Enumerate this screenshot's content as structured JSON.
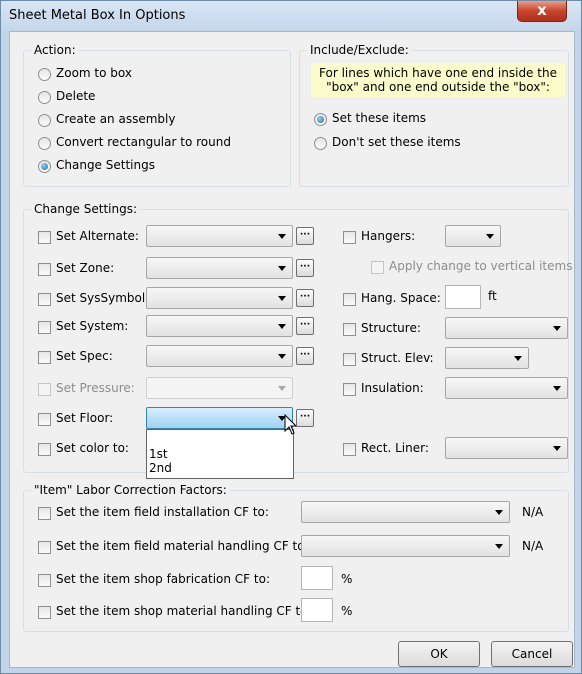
{
  "window": {
    "title": "Sheet Metal Box In Options",
    "close_glyph": "x"
  },
  "action": {
    "group_label": "Action:",
    "options": [
      {
        "label": "Zoom to box",
        "selected": false
      },
      {
        "label": "Delete",
        "selected": false
      },
      {
        "label": "Create an assembly",
        "selected": false
      },
      {
        "label": "Convert rectangular to round",
        "selected": false
      },
      {
        "label": "Change Settings",
        "selected": true
      }
    ]
  },
  "include": {
    "group_label": "Include/Exclude:",
    "note": "For lines which have one end inside the \"box\" and one end outside the \"box\":",
    "options": [
      {
        "label": "Set these items",
        "selected": true
      },
      {
        "label": "Don't set these items",
        "selected": false
      }
    ]
  },
  "settings": {
    "group_label": "Change Settings:",
    "left": [
      {
        "label": "Set Alternate:",
        "enabled": true,
        "checked": false
      },
      {
        "label": "Set Zone:",
        "enabled": true,
        "checked": false
      },
      {
        "label": "Set SysSymbol:",
        "enabled": true,
        "checked": false
      },
      {
        "label": "Set System:",
        "enabled": true,
        "checked": false
      },
      {
        "label": "Set Spec:",
        "enabled": true,
        "checked": false
      },
      {
        "label": "Set Pressure:",
        "enabled": false,
        "checked": false
      },
      {
        "label": "Set Floor:",
        "enabled": true,
        "checked": false
      },
      {
        "label": "Set color to:",
        "enabled": true,
        "checked": false
      }
    ],
    "ellipsis_glyph": "···",
    "floor_dropdown_options": [
      "1st",
      "2nd"
    ],
    "right": {
      "hangers": "Hangers:",
      "apply_vertical": "Apply change to vertical items",
      "hang_space": "Hang. Space:",
      "hang_space_unit": "ft",
      "structure": "Structure:",
      "struct_elev": "Struct. Elev:",
      "insulation": "Insulation:",
      "rect_liner": "Rect. Liner:"
    }
  },
  "labor": {
    "group_label": "\"Item\" Labor Correction Factors:",
    "rows": [
      {
        "label": "Set the item field installation CF to:",
        "suffix": "N/A"
      },
      {
        "label": "Set the item field material handling CF to:",
        "suffix": "N/A"
      },
      {
        "label": "Set the item shop fabrication CF to:",
        "suffix": "%"
      },
      {
        "label": "Set the item shop material handling CF to:",
        "suffix": "%"
      }
    ]
  },
  "buttons": {
    "ok": "OK",
    "cancel": "Cancel"
  }
}
